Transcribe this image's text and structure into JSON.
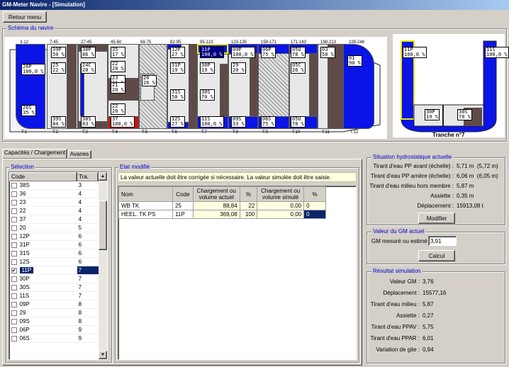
{
  "window": {
    "title": "GM-Meter Navire - [Simulation]"
  },
  "menu": {
    "back": "Retour menu"
  },
  "schema": {
    "title": "Schéma du navire",
    "frames": [
      "3-12",
      "7-45",
      "27-45",
      "45-60",
      "68-75",
      "82-95",
      "95-123",
      "123-135",
      "159-171",
      "171-183",
      "198-213",
      "228-248"
    ],
    "sections": [
      "T.1",
      "T.2",
      "T.3",
      "T.4",
      "T.5",
      "T.6",
      "T.7",
      "T.8",
      "T.9",
      "T.10",
      "T.11",
      "T.12"
    ],
    "labels": [
      {
        "id": "26P",
        "pct": "100,0 %"
      },
      {
        "id": "26S",
        "pct": "35 %"
      },
      {
        "id": "39P",
        "pct": "50 %"
      },
      {
        "id": "25",
        "pct": "22 %"
      },
      {
        "id": "39S",
        "pct": "84 %"
      },
      {
        "id": "38P",
        "pct": "86 %"
      },
      {
        "id": "24C",
        "pct": "20 %"
      },
      {
        "id": "38S",
        "pct": "83 %"
      },
      {
        "id": "35",
        "pct": "17 %"
      },
      {
        "id": "22",
        "pct": "20 %"
      },
      {
        "id": "23",
        "pct": "21 %"
      },
      {
        "id": "21",
        "pct": "20 %"
      },
      {
        "id": "22",
        "pct": "20 %"
      },
      {
        "id": "37",
        "pct": "100,0 %"
      },
      {
        "id": "20",
        "pct": "26 %"
      },
      {
        "id": "12P",
        "pct": "27 %"
      },
      {
        "id": "31P",
        "pct": "19 %"
      },
      {
        "id": "31S",
        "pct": "50 %"
      },
      {
        "id": "12S",
        "pct": "27 %"
      },
      {
        "id": "11P",
        "pct": "100,0 %"
      },
      {
        "id": "30P",
        "pct": "19 %"
      },
      {
        "id": "30S",
        "pct": "70 %"
      },
      {
        "id": "11S",
        "pct": "100,0 %"
      },
      {
        "id": "09P",
        "pct": "100,0 %"
      },
      {
        "id": "29",
        "pct": "20 %"
      },
      {
        "id": "09S",
        "pct": "33 %"
      },
      {
        "id": "06P",
        "pct": "75 %"
      },
      {
        "id": "06S",
        "pct": "75 %"
      },
      {
        "id": "05U",
        "pct": "78 %"
      },
      {
        "id": "05C",
        "pct": "26 %"
      },
      {
        "id": "05U",
        "pct": "78 %"
      },
      {
        "id": "03",
        "pct": "50 %"
      },
      {
        "id": "01",
        "pct": "90 %"
      }
    ],
    "section_view": {
      "title": "Tranche n°7",
      "labels": [
        {
          "id": "11P",
          "pct": "100,0 %"
        },
        {
          "id": "11S",
          "pct": "100,0 %"
        },
        {
          "id": "30P",
          "pct": "19 %"
        },
        {
          "id": "30S",
          "pct": "70 %"
        }
      ]
    }
  },
  "tabs": [
    "Capacités / Chargement",
    "Avaries"
  ],
  "selection": {
    "title": "Sélection",
    "headers": [
      "Code",
      "Tra."
    ],
    "rows": [
      {
        "code": "38S",
        "tra": "3",
        "checked": false
      },
      {
        "code": "36",
        "tra": "4",
        "checked": false
      },
      {
        "code": "23",
        "tra": "4",
        "checked": false
      },
      {
        "code": "22",
        "tra": "4",
        "checked": false
      },
      {
        "code": "37",
        "tra": "4",
        "checked": false
      },
      {
        "code": "20",
        "tra": "5",
        "checked": false
      },
      {
        "code": "12P",
        "tra": "6",
        "checked": false
      },
      {
        "code": "31P",
        "tra": "6",
        "checked": false
      },
      {
        "code": "31S",
        "tra": "6",
        "checked": false
      },
      {
        "code": "12S",
        "tra": "6",
        "checked": false
      },
      {
        "code": "11P",
        "tra": "7",
        "checked": true
      },
      {
        "code": "30P",
        "tra": "7",
        "checked": false
      },
      {
        "code": "30S",
        "tra": "7",
        "checked": false
      },
      {
        "code": "11S",
        "tra": "7",
        "checked": false
      },
      {
        "code": "09P",
        "tra": "8",
        "checked": false
      },
      {
        "code": "29",
        "tra": "8",
        "checked": false
      },
      {
        "code": "09S",
        "tra": "8",
        "checked": false
      },
      {
        "code": "06P",
        "tra": "9",
        "checked": false
      },
      {
        "code": "06S",
        "tra": "9",
        "checked": false
      }
    ]
  },
  "etat": {
    "title": "Etat modifié",
    "notice": "La valeur actuelle doit être corrigée si nécessaire. La valeur simulée doit être saisie.",
    "headers": [
      "Nom",
      "Code",
      "Chargement ou volume actuel",
      "%",
      "Chargement ou volume simulé",
      "%"
    ],
    "rows": [
      {
        "nom": "WB TK",
        "code": "25",
        "actuel": "88,84",
        "pct": "22",
        "simule": "0,00",
        "pct2": "0"
      },
      {
        "nom": "HEEL. TK PS",
        "code": "11P",
        "actuel": "369,08",
        "pct": "100",
        "simule": "0,00",
        "pct2": "0"
      }
    ]
  },
  "hydro": {
    "title": "Situation hydrostatique actuelle",
    "rows": [
      {
        "label": "Tirant d'eau PP avant (échelle) :",
        "value": "5,71 m  (5,72 m)"
      },
      {
        "label": "Tirant d'eau PP arrière (échelle) :",
        "value": "6,06 m  (6,05 m)"
      },
      {
        "label": "Tirant d'eau milieu hors membre :",
        "value": "5,87 m"
      },
      {
        "label": "Assiette :",
        "value": "0,35 m"
      },
      {
        "label": "Déplacement :",
        "value": "15913,08 t"
      }
    ],
    "modify": "Modifier"
  },
  "gm": {
    "title": "Valeur du GM actuel",
    "label": "GM mesuré ou estimé :",
    "value": "3,91",
    "calc": "Calcul"
  },
  "result": {
    "title": "Résultat simulation",
    "rows": [
      {
        "label": "Valeur GM :",
        "value": "3,76"
      },
      {
        "label": "Déplacement :",
        "value": "15577,16"
      },
      {
        "label": "Tirant d'eau milieu :",
        "value": "5,87"
      },
      {
        "label": "Assiette :",
        "value": "0,27"
      },
      {
        "label": "Tirant d'eau PPAV :",
        "value": "5,75"
      },
      {
        "label": "Tirant d'eau PPAR :",
        "value": "6,01"
      },
      {
        "label": "Variation de gite :",
        "value": "0,94"
      }
    ]
  }
}
